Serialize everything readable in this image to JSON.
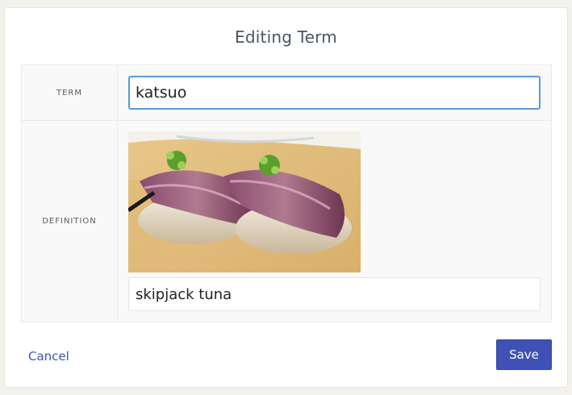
{
  "modal": {
    "title": "Editing Term"
  },
  "form": {
    "term_label": "TERM",
    "term_value": "katsuo",
    "definition_label": "DEFINITION",
    "definition_value": "skipjack tuna"
  },
  "actions": {
    "cancel_label": "Cancel",
    "save_label": "Save"
  },
  "colors": {
    "accent": "#3f51b5",
    "link": "#3a55b4",
    "focus_border": "#5b9bd5",
    "page_background": "#f3f1ec"
  }
}
